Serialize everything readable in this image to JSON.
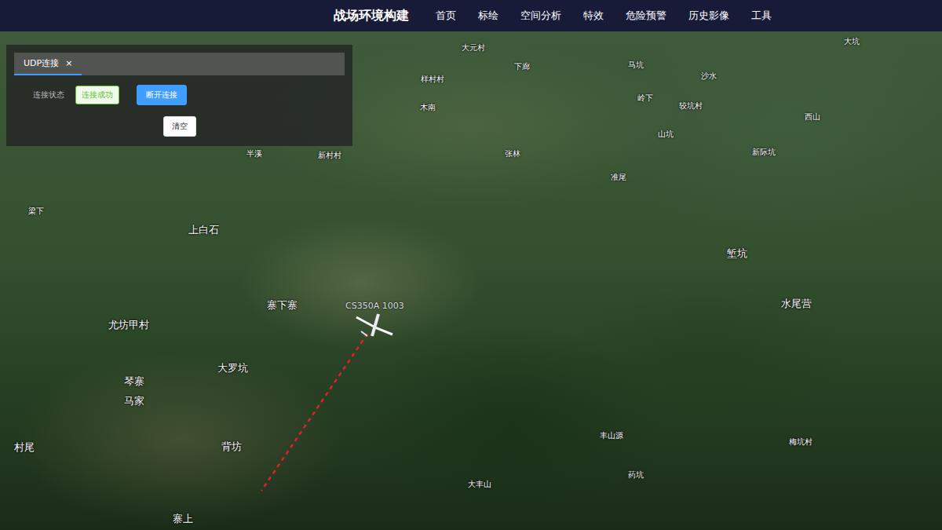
{
  "app": {
    "title": "战场环境构建"
  },
  "nav": [
    {
      "label": "首页"
    },
    {
      "label": "标绘"
    },
    {
      "label": "空间分析"
    },
    {
      "label": "特效"
    },
    {
      "label": "危险预警"
    },
    {
      "label": "历史影像"
    },
    {
      "label": "工具"
    }
  ],
  "panel": {
    "tabs": [
      {
        "label": "UDP连接",
        "close": "×",
        "selected": true
      }
    ],
    "status_label": "连接状态",
    "status": {
      "text": "连接成功",
      "color": "#67c23a"
    },
    "buttons": [
      {
        "label": "断开连接",
        "kind": "primary"
      },
      {
        "label": "清空",
        "kind": "plain"
      }
    ]
  },
  "map": {
    "aircraft": {
      "label": "CS350A 1003"
    },
    "places": [
      "大元村",
      "马坑",
      "大坑",
      "沙水",
      "下廊",
      "样村村",
      "木南",
      "岭下",
      "较坑村",
      "山坑",
      "西山",
      "新际坑",
      "新村村",
      "张林",
      "准尾",
      "半溪",
      "上白石",
      "梁下",
      "寨下寨",
      "尤坊甲村",
      "大罗坑",
      "琴寨",
      "马家",
      "村尾",
      "背坊",
      "寨上",
      "大丰山",
      "水尾营",
      "堑坑",
      "药坑",
      "丰山源",
      "梅坑村"
    ]
  }
}
